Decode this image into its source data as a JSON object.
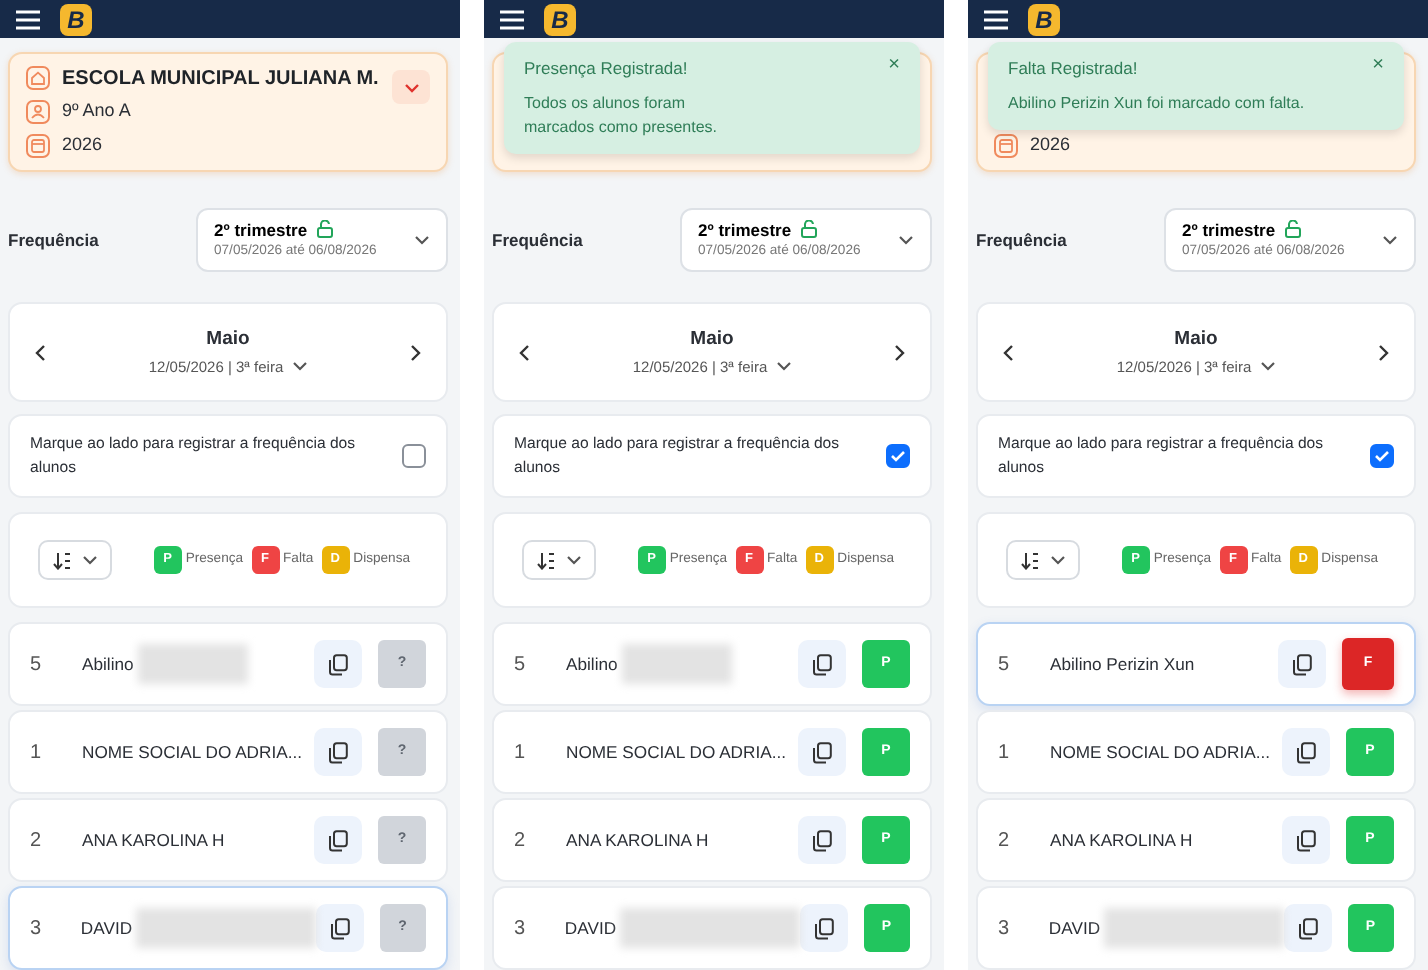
{
  "screens": [
    {
      "logo": "B",
      "school_card": {
        "toggle": {
          "expanded": false
        },
        "rows": [
          {
            "kind": "school",
            "text": "ESCOLA MUNICIPAL JULIANA M."
          },
          {
            "kind": "class",
            "text": "9º Ano A"
          },
          {
            "kind": "year",
            "text": "2026"
          }
        ]
      },
      "frequency": {
        "label": "Frequência",
        "period": "2º trimestre",
        "locked": false,
        "dates": "07/05/2026 até 06/08/2026"
      },
      "month": {
        "name": "Maio",
        "date": "12/05/2026 | 3ª feira"
      },
      "mark_all": {
        "text": "Marque ao lado para registrar a frequência dos alunos",
        "checked": false
      },
      "legend": [
        {
          "code": "P",
          "label": "Presença",
          "color": "#22c55e"
        },
        {
          "code": "F",
          "label": "Falta",
          "color": "#ef4444"
        },
        {
          "code": "D",
          "label": "Dispensa",
          "color": "#eab308"
        }
      ],
      "students": [
        {
          "number": "5",
          "name": "Abilino",
          "redacted": true,
          "highlighted": false,
          "status": {
            "kind": "pending",
            "text": "?"
          }
        },
        {
          "number": "1",
          "name": "NOME SOCIAL DO ADRIA...",
          "redacted": false,
          "highlighted": false,
          "status": {
            "kind": "pending",
            "text": "?"
          }
        },
        {
          "number": "2",
          "name": "ANA KAROLINA H",
          "redacted": false,
          "highlighted": false,
          "status": {
            "kind": "pending",
            "text": "?"
          }
        },
        {
          "number": "3",
          "name": "DAVID",
          "redacted": true,
          "highlighted": true,
          "status": {
            "kind": "pending",
            "text": "?"
          }
        }
      ]
    },
    {
      "logo": "B",
      "toast": {
        "title": "Presença Registrada!",
        "message": "Todos os alunos foram\nmarcados como presentes.",
        "close": "×"
      },
      "frequency": {
        "label": "Frequência",
        "period": "2º trimestre",
        "locked": false,
        "dates": "07/05/2026 até 06/08/2026"
      },
      "month": {
        "name": "Maio",
        "date": "12/05/2026 | 3ª feira"
      },
      "mark_all": {
        "text": "Marque ao lado para registrar a frequência dos alunos",
        "checked": true
      },
      "legend": [
        {
          "code": "P",
          "label": "Presença",
          "color": "#22c55e"
        },
        {
          "code": "F",
          "label": "Falta",
          "color": "#ef4444"
        },
        {
          "code": "D",
          "label": "Dispensa",
          "color": "#eab308"
        }
      ],
      "students": [
        {
          "number": "5",
          "name": "Abilino",
          "redacted": true,
          "highlighted": false,
          "status": {
            "kind": "present",
            "text": "P"
          }
        },
        {
          "number": "1",
          "name": "NOME SOCIAL DO ADRIA...",
          "redacted": false,
          "highlighted": false,
          "status": {
            "kind": "present",
            "text": "P"
          }
        },
        {
          "number": "2",
          "name": "ANA KAROLINA H",
          "redacted": false,
          "highlighted": false,
          "status": {
            "kind": "present",
            "text": "P"
          }
        },
        {
          "number": "3",
          "name": "DAVID",
          "redacted": true,
          "highlighted": false,
          "status": {
            "kind": "present",
            "text": "P"
          }
        }
      ]
    },
    {
      "logo": "B",
      "school_card": {
        "rows": [
          {
            "kind": "year",
            "text": "2026"
          }
        ]
      },
      "toast": {
        "title": "Falta Registrada!",
        "message": "Abilino Perizin Xun foi marcado com falta.",
        "close": "×"
      },
      "frequency": {
        "label": "Frequência",
        "period": "2º trimestre",
        "locked": false,
        "dates": "07/05/2026 até 06/08/2026"
      },
      "month": {
        "name": "Maio",
        "date": "12/05/2026 | 3ª feira"
      },
      "mark_all": {
        "text": "Marque ao lado para registrar a frequência dos alunos",
        "checked": true
      },
      "legend": [
        {
          "code": "P",
          "label": "Presença",
          "color": "#22c55e"
        },
        {
          "code": "F",
          "label": "Falta",
          "color": "#ef4444"
        },
        {
          "code": "D",
          "label": "Dispensa",
          "color": "#eab308"
        }
      ],
      "students": [
        {
          "number": "5",
          "name": "Abilino Perizin Xun",
          "redacted": false,
          "highlighted": true,
          "status": {
            "kind": "absent",
            "text": "F"
          }
        },
        {
          "number": "1",
          "name": "NOME SOCIAL DO ADRIA...",
          "redacted": false,
          "highlighted": false,
          "status": {
            "kind": "present",
            "text": "P"
          }
        },
        {
          "number": "2",
          "name": "ANA KAROLINA H",
          "redacted": false,
          "highlighted": false,
          "status": {
            "kind": "present",
            "text": "P"
          }
        },
        {
          "number": "3",
          "name": "DAVID",
          "redacted": true,
          "highlighted": false,
          "status": {
            "kind": "present",
            "text": "P"
          }
        }
      ]
    }
  ]
}
